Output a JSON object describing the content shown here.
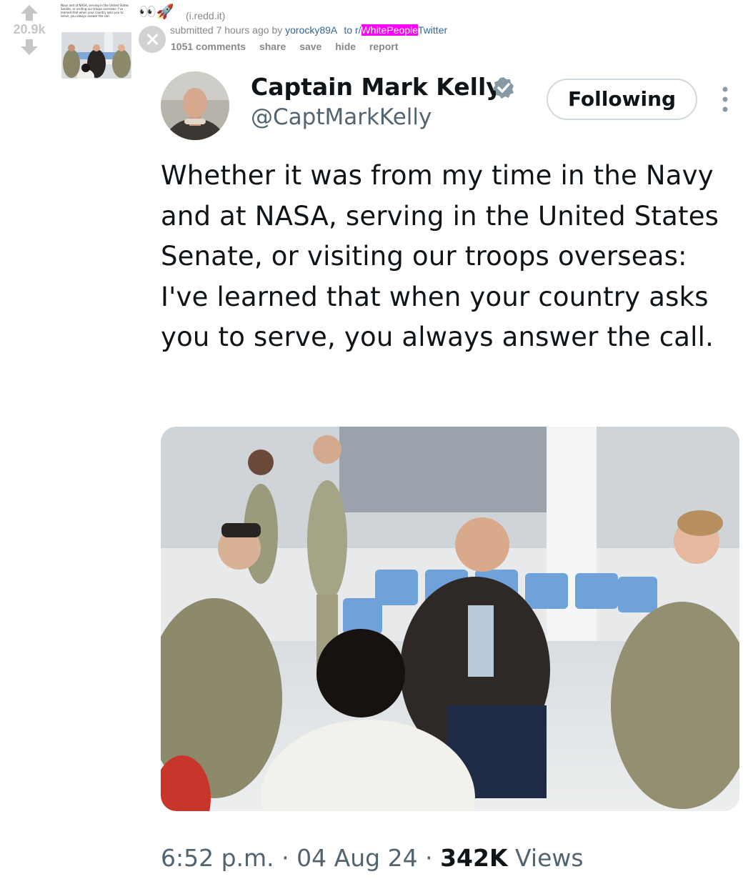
{
  "post": {
    "score": "20.9k",
    "flair_emoji": "👀🚀",
    "domain": "i.redd.it",
    "tagline": {
      "submitted": "submitted",
      "time": "7 hours ago",
      "by": "by",
      "author": "yorocky89A",
      "to": "to",
      "subreddit_prefix": "r/",
      "subreddit_highlight": "WhitePeople",
      "subreddit_rest": "Twitter"
    },
    "buttons": {
      "comments": "1051 comments",
      "share": "share",
      "save": "save",
      "hide": "hide",
      "report": "report"
    },
    "thumbnail_text": "Navy and at NASA, serving in the United States Senate, or visiting our troops overseas: I've learned that when your country asks you to serve, you always answer the call."
  },
  "tweet": {
    "name": "Captain Mark Kelly",
    "handle": "@CaptMarkKelly",
    "follow_label": "Following",
    "text": "Whether it was from my time in the Navy and at NASA, serving in the United States Senate, or visiting our troops overseas: I've learned that when your country asks you to serve, you always answer the call.",
    "time": "6:52 p.m.",
    "date": "04 Aug 24",
    "views_count": "342K",
    "views_label": "Views",
    "separator": "·"
  },
  "colors": {
    "link": "#336699",
    "subreddit_highlight_bg": "#ff00ff",
    "muted": "#888888",
    "tweet_secondary": "#536471",
    "verified": "#8899a6"
  }
}
